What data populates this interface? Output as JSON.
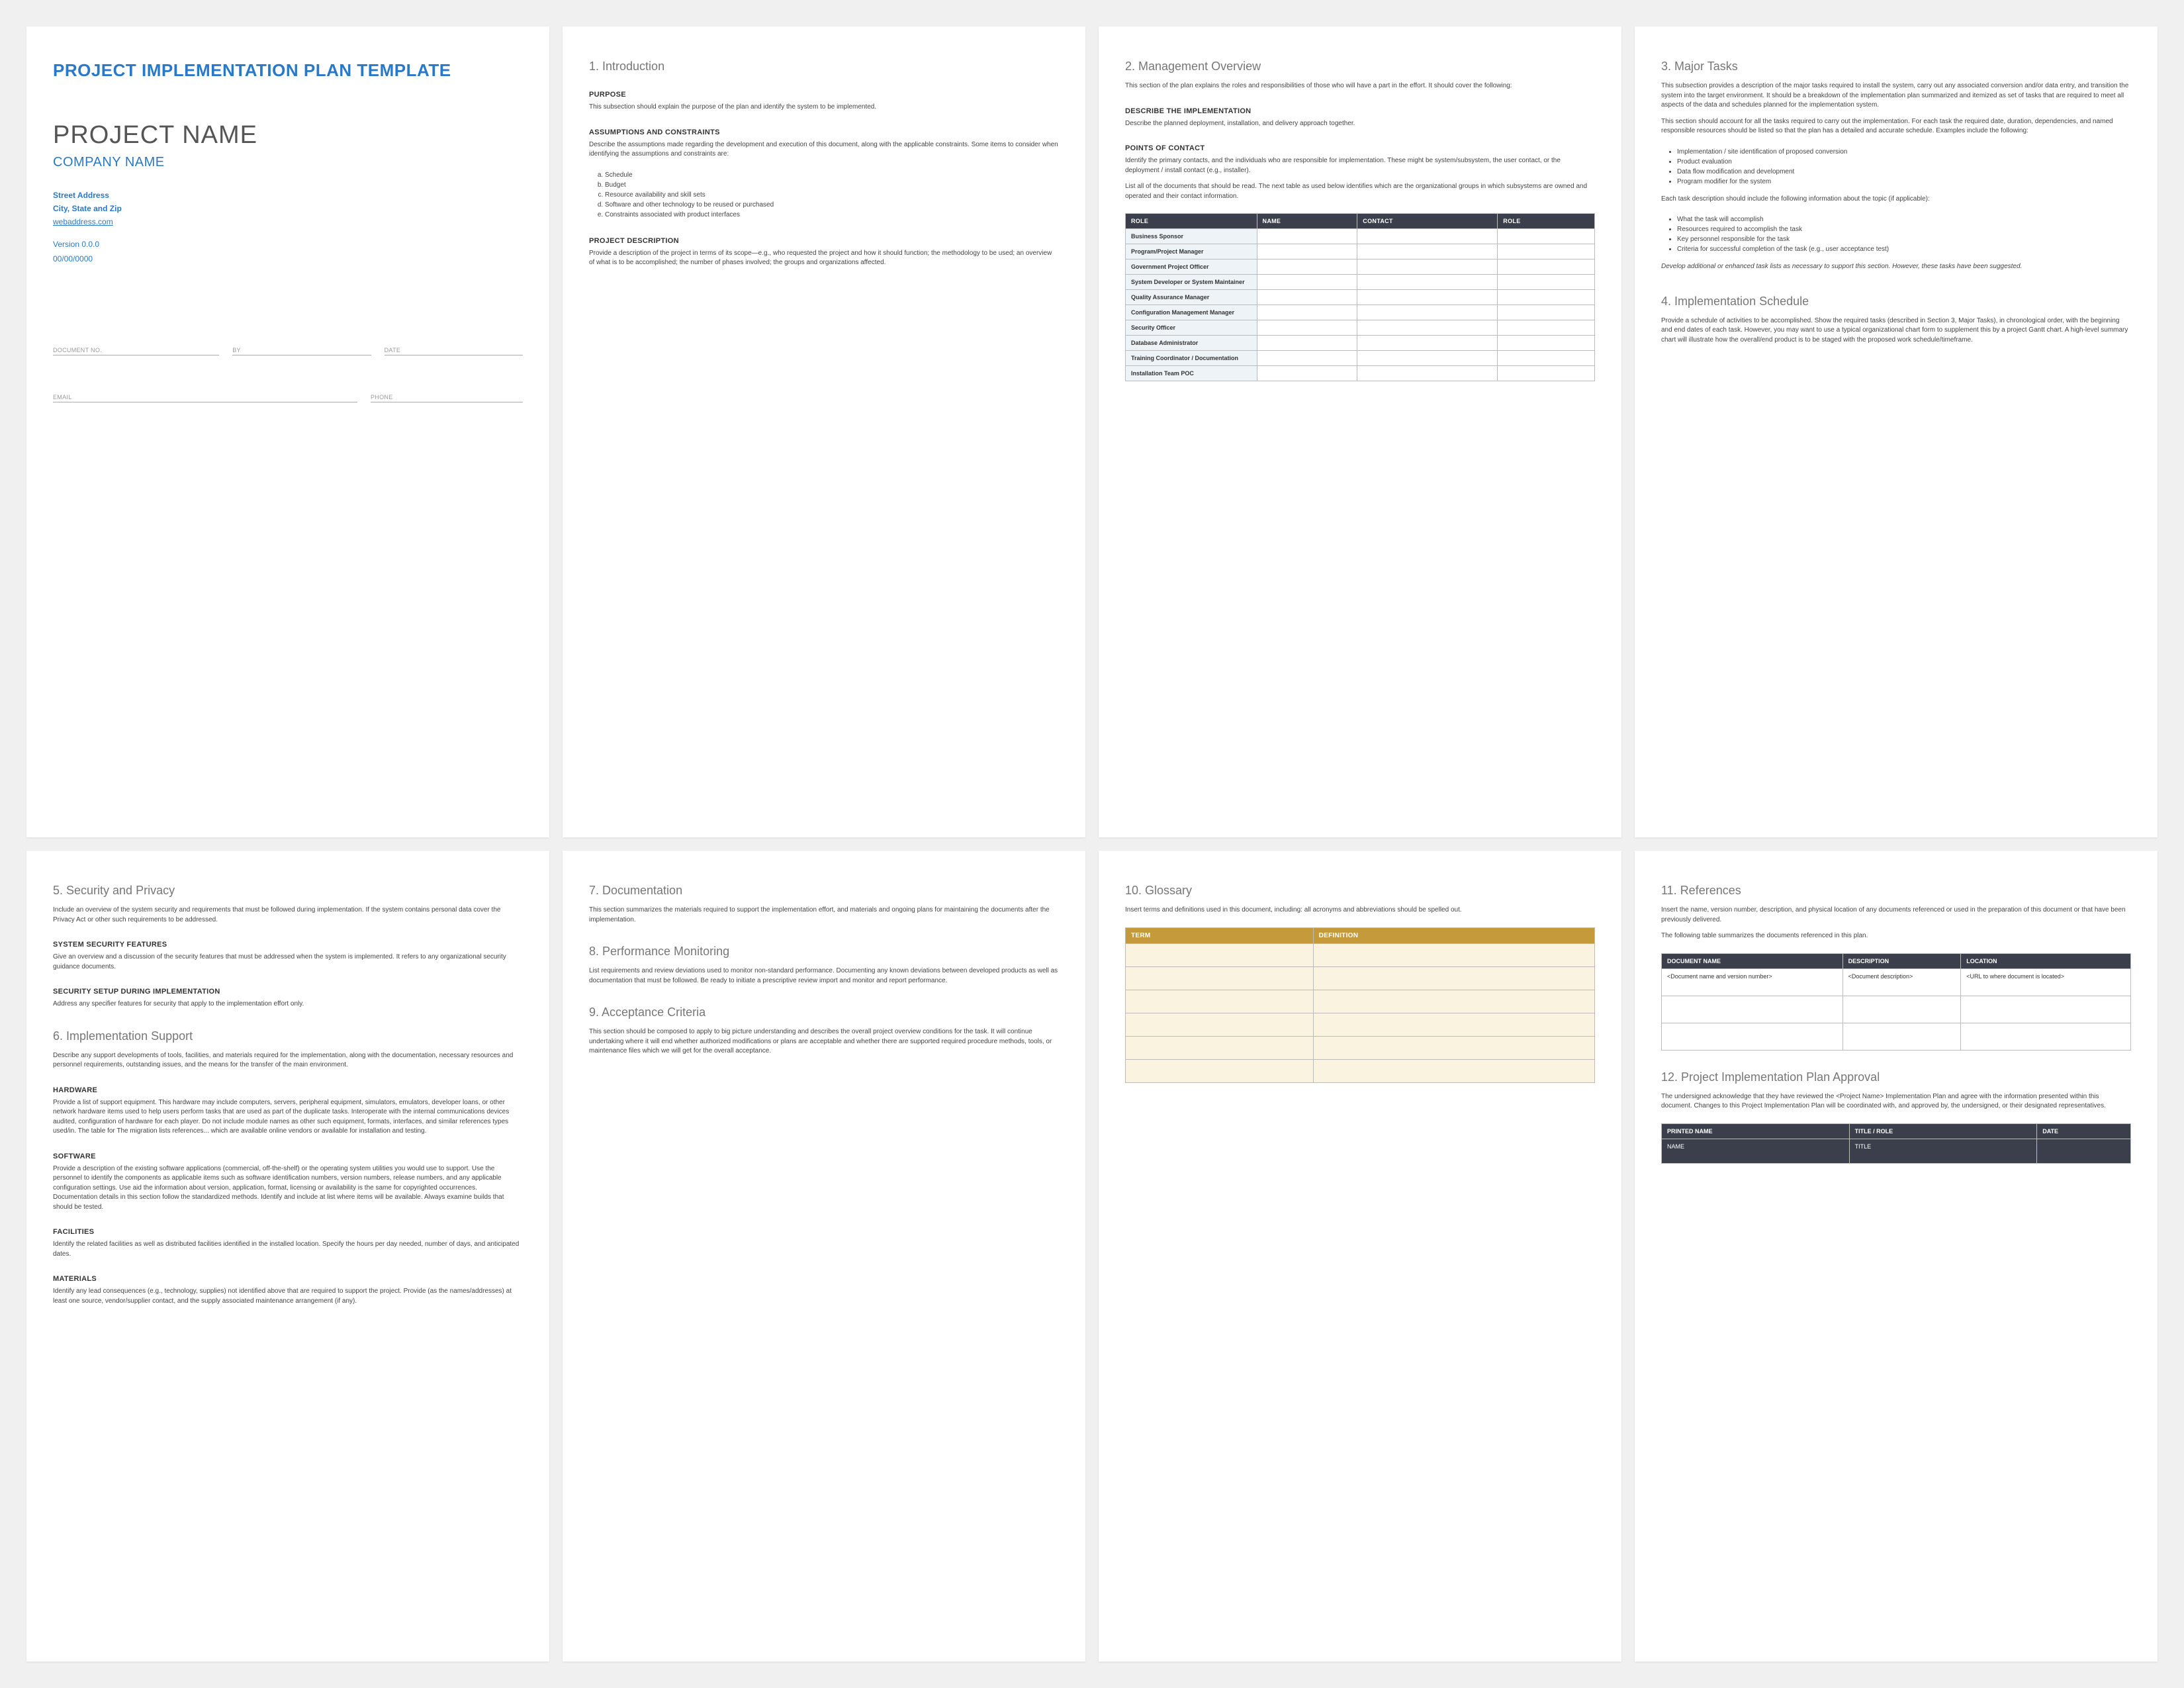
{
  "cover": {
    "template_title": "PROJECT IMPLEMENTATION PLAN TEMPLATE",
    "project_name": "PROJECT NAME",
    "company_name": "COMPANY NAME",
    "street": "Street Address",
    "city": "City, State and Zip",
    "web": "webaddress.com",
    "version": "Version 0.0.0",
    "date": "00/00/0000",
    "sig": {
      "document_no": "DOCUMENT NO.",
      "by": "BY",
      "date": "DATE",
      "email": "EMAIL",
      "phone": "PHONE"
    }
  },
  "p1": {
    "h_intro": "1. Introduction",
    "sub_purpose": "Purpose",
    "purpose_text": "This subsection should explain the purpose of the plan and identify the system to be implemented.",
    "sub_assump": "Assumptions and Constraints",
    "assump_text1": "Describe the assumptions made regarding the development and execution of this document, along with the applicable constraints. Some items to consider when identifying the assumptions and constraints are:",
    "assump_list": [
      "Schedule",
      "Budget",
      "Resource availability and skill sets",
      "Software and other technology to be reused or purchased",
      "Constraints associated with product interfaces"
    ],
    "sub_proj": "Project Description",
    "proj_text": "Provide a description of the project in terms of its scope—e.g., who requested the project and how it should function; the methodology to be used; an overview of what is to be accomplished; the number of phases involved; the groups and organizations affected."
  },
  "p2": {
    "h_mgmt": "2. Management Overview",
    "mgmt_text": "This section of the plan explains the roles and responsibilities of those who will have a part in the effort. It should cover the following:",
    "sub_desc": "Describe the Implementation",
    "desc_text": "Describe the planned deployment, installation, and delivery approach together.",
    "sub_poc": "Points of Contact",
    "poc_text": "Identify the primary contacts, and the individuals who are responsible for implementation. These might be system/subsystem, the user contact, or the deployment / install contact (e.g., installer).",
    "table_intro": "List all of the documents that should be read. The next table as used below identifies which are the organizational groups in which subsystems are owned and operated and their contact information.",
    "cols": [
      "ROLE",
      "NAME",
      "CONTACT",
      "ROLE"
    ],
    "rows": [
      "Business Sponsor",
      "Program/Project Manager",
      "Government Project Officer",
      "System Developer or System Maintainer",
      "Quality Assurance Manager",
      "Configuration Management Manager",
      "Security Officer",
      "Database Administrator",
      "Training Coordinator / Documentation",
      "Installation Team POC"
    ]
  },
  "p3": {
    "h_major": "3. Major Tasks",
    "major_text1": "This subsection provides a description of the major tasks required to install the system, carry out any associated conversion and/or data entry, and transition the system into the target environment. It should be a breakdown of the implementation plan summarized and itemized as set of tasks that are required to meet all aspects of the data and schedules planned for the implementation system.",
    "major_text2": "This section should account for all the tasks required to carry out the implementation. For each task the required date, duration, dependencies, and named responsible resources should be listed so that the plan has a detailed and accurate schedule. Examples include the following:",
    "major_list1": [
      "Implementation / site identification of proposed conversion",
      "Product evaluation",
      "Data flow modification and development",
      "Program modifier for the system"
    ],
    "mid_text": "Each task description should include the following information about the topic (if applicable):",
    "major_list2": [
      "What the task will accomplish",
      "Resources required to accomplish the task",
      "Key personnel responsible for the task",
      "Criteria for successful completion of the task (e.g., user acceptance test)"
    ],
    "note": "Develop additional or enhanced task lists as necessary to support this section. However, these tasks have been suggested.",
    "h_sched": "4. Implementation Schedule",
    "sched_text": "Provide a schedule of activities to be accomplished. Show the required tasks (described in Section 3, Major Tasks), in chronological order, with the beginning and end dates of each task. However, you may want to use a typical organizational chart form to supplement this by a project Gantt chart. A high-level summary chart will illustrate how the overall/end product is to be staged with the proposed work schedule/timeframe."
  },
  "p5": {
    "h_sec": "5. Security and Privacy",
    "sec_text": "Include an overview of the system security and requirements that must be followed during implementation. If the system contains personal data cover the Privacy Act or other such requirements to be addressed.",
    "sub_secfeat": "System Security Features",
    "secfeat_text": "Give an overview and a discussion of the security features that must be addressed when the system is implemented. It refers to any organizational security guidance documents.",
    "sub_secsetup": "Security Setup During Implementation",
    "secsetup_text": "Address any specifier features for security that apply to the implementation effort only.",
    "h_support": "6. Implementation Support",
    "support_text": "Describe any support developments of tools, facilities, and materials required for the implementation, along with the documentation, necessary resources and personnel requirements, outstanding issues, and the means for the transfer of the main environment.",
    "sub_hw": "Hardware",
    "hw_text": "Provide a list of support equipment. This hardware may include computers, servers, peripheral equipment, simulators, emulators, developer loans, or other network hardware items used to help users perform tasks that are used as part of the duplicate tasks. Interoperate with the internal communications devices audited, configuration of hardware for each player. Do not include module names as other such equipment, formats, interfaces, and similar references types used/in. The table for The migration lists references... which are available online vendors or available for installation and testing.",
    "sub_sw": "Software",
    "sw_text": "Provide a description of the existing software applications (commercial, off-the-shelf) or the operating system utilities you would use to support. Use the personnel to identify the components as applicable items such as software identification numbers, version numbers, release numbers, and any applicable configuration settings. Use aid the information about version, application, format, licensing or availability is the same for copyrighted occurrences. Documentation details in this section follow the standardized methods. Identify and include at list where items will be available. Always examine builds that should be tested.",
    "sub_fac": "Facilities",
    "fac_text": "Identify the related facilities as well as distributed facilities identified in the installed location. Specify the hours per day needed, number of days, and anticipated dates.",
    "sub_mat": "Materials",
    "mat_text": "Identify any lead consequences (e.g., technology, supplies) not identified above that are required to support the project. Provide (as the names/addresses) at least one source, vendor/supplier contact, and the supply associated maintenance arrangement (if any)."
  },
  "p6": {
    "h_doc": "7. Documentation",
    "doc_text": "This section summarizes the materials required to support the implementation effort, and materials and ongoing plans for maintaining the documents after the implementation.",
    "h_perf": "8. Performance Monitoring",
    "perf_text": "List requirements and review deviations used to monitor non-standard performance. Documenting any known deviations between developed products as well as documentation that must be followed. Be ready to initiate a prescriptive review import and monitor and report performance.",
    "h_accept": "9. Acceptance Criteria",
    "accept_text": "This section should be composed to apply to big picture understanding and describes the overall project overview conditions for the task. It will continue undertaking where it will end whether authorized modifications or plans are acceptable and whether there are supported required procedure methods, tools, or maintenance files which we will get for the overall acceptance."
  },
  "p10": {
    "h_gloss": "10. Glossary",
    "gloss_text": "Insert terms and definitions used in this document, including: all acronyms and abbreviations should be spelled out.",
    "cols": [
      "TERM",
      "DEFINITION"
    ]
  },
  "p11": {
    "h_ref": "11. References",
    "ref_text1": "Insert the name, version number, description, and physical location of any documents referenced or used in the preparation of this document or that have been previously delivered.",
    "ref_text2": "The following table summarizes the documents referenced in this plan.",
    "cols": [
      "DOCUMENT NAME",
      "DESCRIPTION",
      "LOCATION"
    ],
    "row1": [
      "<Document name and version number>",
      "<Document description>",
      "<URL to where document is located>"
    ],
    "h_approve": "12. Project Implementation Plan Approval",
    "approve_text": "The undersigned acknowledge that they have reviewed the <Project Name> Implementation Plan and agree with the information presented within this document. Changes to this Project Implementation Plan will be coordinated with, and approved by, the undersigned, or their designated representatives.",
    "acols": [
      "PRINTED NAME",
      "TITLE / ROLE",
      "DATE"
    ],
    "arow": [
      "NAME",
      "TITLE"
    ]
  }
}
